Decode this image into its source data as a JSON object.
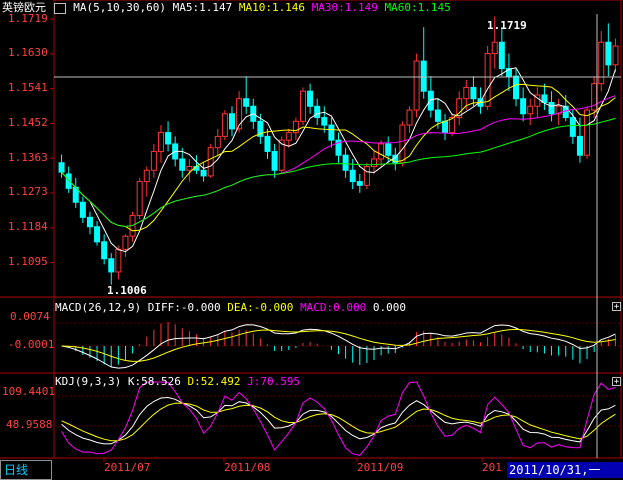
{
  "main_panel": {
    "symbol": "英镑欧元",
    "ma_params": "MA(5,10,30,60)",
    "ma5": "MA5:1.147",
    "ma10": "MA10:1.146",
    "ma30": "MA30:1.149",
    "ma60": "MA60:1.145",
    "high_annotation": "1.1719",
    "low_annotation": "1.1006",
    "y_ticks": [
      "1.1719",
      "1.1630",
      "1.1541",
      "1.1452",
      "1.1363",
      "1.1273",
      "1.1184",
      "1.1095"
    ]
  },
  "macd_panel": {
    "params": "MACD(26,12,9)",
    "diff": "DIFF:-0.000",
    "dea": "DEA:-0.000",
    "macd": "MACD:0.000",
    "extra": "0.000",
    "y_ticks": [
      "0.0074",
      "-0.0001"
    ]
  },
  "kdj_panel": {
    "params": "KDJ(9,3,3)",
    "k": "K:58.526",
    "d": "D:52.492",
    "j": "J:70.595",
    "y_ticks": [
      "109.4401",
      "48.9588"
    ]
  },
  "x_axis": {
    "labels": [
      "2011/07",
      "2011/08",
      "2011/09",
      "201"
    ]
  },
  "period_tab": "日线",
  "crosshair_date": "2011/10/31,一",
  "colors": {
    "up": "#ff3333",
    "down": "#00ffff",
    "ma5": "#ffffff",
    "ma10": "#ffff00",
    "ma30": "#ff00ff",
    "ma60": "#00ff00",
    "axis": "#b00000"
  },
  "chart_data": {
    "type": "candlestick",
    "ylim": [
      1.1006,
      1.1719
    ],
    "ohlc": [
      [
        1.133,
        1.1352,
        1.129,
        1.1305
      ],
      [
        1.13,
        1.132,
        1.125,
        1.1262
      ],
      [
        1.1265,
        1.129,
        1.121,
        1.1225
      ],
      [
        1.1225,
        1.124,
        1.117,
        1.1185
      ],
      [
        1.1185,
        1.12,
        1.114,
        1.116
      ],
      [
        1.116,
        1.1175,
        1.111,
        1.112
      ],
      [
        1.112,
        1.114,
        1.106,
        1.1075
      ],
      [
        1.1075,
        1.109,
        1.1006,
        1.104
      ],
      [
        1.104,
        1.111,
        1.102,
        1.11
      ],
      [
        1.11,
        1.114,
        1.108,
        1.1135
      ],
      [
        1.1135,
        1.12,
        1.112,
        1.119
      ],
      [
        1.119,
        1.129,
        1.118,
        1.128
      ],
      [
        1.128,
        1.132,
        1.124,
        1.131
      ],
      [
        1.131,
        1.138,
        1.129,
        1.136
      ],
      [
        1.136,
        1.143,
        1.133,
        1.141
      ],
      [
        1.141,
        1.144,
        1.136,
        1.138
      ],
      [
        1.138,
        1.14,
        1.132,
        1.134
      ],
      [
        1.134,
        1.137,
        1.129,
        1.131
      ],
      [
        1.131,
        1.134,
        1.128,
        1.132
      ],
      [
        1.132,
        1.135,
        1.13,
        1.131
      ],
      [
        1.131,
        1.133,
        1.128,
        1.1295
      ],
      [
        1.1295,
        1.138,
        1.129,
        1.137
      ],
      [
        1.137,
        1.142,
        1.135,
        1.14
      ],
      [
        1.14,
        1.147,
        1.139,
        1.146
      ],
      [
        1.146,
        1.148,
        1.14,
        1.142
      ],
      [
        1.142,
        1.152,
        1.141,
        1.15
      ],
      [
        1.15,
        1.156,
        1.146,
        1.148
      ],
      [
        1.148,
        1.15,
        1.142,
        1.144
      ],
      [
        1.144,
        1.146,
        1.138,
        1.14
      ],
      [
        1.14,
        1.142,
        1.134,
        1.136
      ],
      [
        1.136,
        1.138,
        1.129,
        1.131
      ],
      [
        1.131,
        1.14,
        1.13,
        1.139
      ],
      [
        1.139,
        1.142,
        1.137,
        1.141
      ],
      [
        1.141,
        1.145,
        1.139,
        1.144
      ],
      [
        1.144,
        1.153,
        1.143,
        1.152
      ],
      [
        1.152,
        1.154,
        1.146,
        1.148
      ],
      [
        1.148,
        1.15,
        1.143,
        1.145
      ],
      [
        1.145,
        1.148,
        1.141,
        1.143
      ],
      [
        1.143,
        1.145,
        1.137,
        1.139
      ],
      [
        1.139,
        1.141,
        1.133,
        1.135
      ],
      [
        1.135,
        1.137,
        1.129,
        1.131
      ],
      [
        1.131,
        1.134,
        1.126,
        1.128
      ],
      [
        1.128,
        1.13,
        1.125,
        1.127
      ],
      [
        1.127,
        1.133,
        1.126,
        1.132
      ],
      [
        1.132,
        1.136,
        1.13,
        1.134
      ],
      [
        1.134,
        1.139,
        1.132,
        1.138
      ],
      [
        1.138,
        1.14,
        1.133,
        1.135
      ],
      [
        1.135,
        1.137,
        1.131,
        1.133
      ],
      [
        1.133,
        1.144,
        1.132,
        1.143
      ],
      [
        1.143,
        1.148,
        1.141,
        1.147
      ],
      [
        1.147,
        1.162,
        1.145,
        1.16
      ],
      [
        1.16,
        1.169,
        1.15,
        1.152
      ],
      [
        1.152,
        1.156,
        1.145,
        1.147
      ],
      [
        1.147,
        1.15,
        1.142,
        1.144
      ],
      [
        1.144,
        1.146,
        1.139,
        1.141
      ],
      [
        1.141,
        1.146,
        1.14,
        1.145
      ],
      [
        1.145,
        1.152,
        1.143,
        1.15
      ],
      [
        1.15,
        1.155,
        1.147,
        1.153
      ],
      [
        1.153,
        1.156,
        1.148,
        1.15
      ],
      [
        1.15,
        1.153,
        1.146,
        1.148
      ],
      [
        1.148,
        1.164,
        1.147,
        1.162
      ],
      [
        1.162,
        1.1719,
        1.158,
        1.165
      ],
      [
        1.165,
        1.169,
        1.156,
        1.158
      ],
      [
        1.158,
        1.162,
        1.152,
        1.156
      ],
      [
        1.156,
        1.158,
        1.148,
        1.15
      ],
      [
        1.15,
        1.153,
        1.144,
        1.146
      ],
      [
        1.146,
        1.15,
        1.143,
        1.148
      ],
      [
        1.148,
        1.153,
        1.145,
        1.151
      ],
      [
        1.151,
        1.154,
        1.147,
        1.149
      ],
      [
        1.149,
        1.152,
        1.144,
        1.146
      ],
      [
        1.146,
        1.15,
        1.143,
        1.148
      ],
      [
        1.148,
        1.151,
        1.144,
        1.145
      ],
      [
        1.145,
        1.147,
        1.138,
        1.14
      ],
      [
        1.14,
        1.145,
        1.133,
        1.135
      ],
      [
        1.135,
        1.148,
        1.134,
        1.147
      ],
      [
        1.147,
        1.156,
        1.145,
        1.154
      ],
      [
        1.154,
        1.168,
        1.152,
        1.165
      ],
      [
        1.165,
        1.17,
        1.156,
        1.159
      ],
      [
        1.159,
        1.166,
        1.157,
        1.164
      ]
    ]
  }
}
